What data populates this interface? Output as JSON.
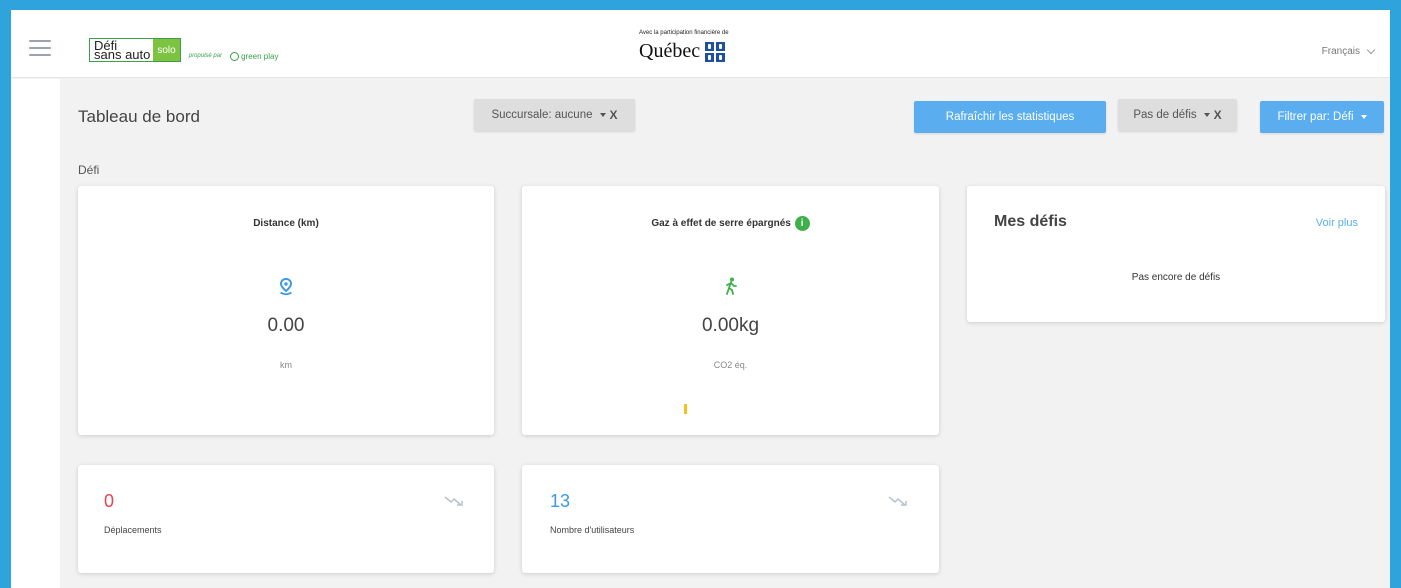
{
  "header": {
    "logo": {
      "line1": "Défi",
      "line2": "sans auto",
      "solo": "solo",
      "propulse": "propulsé par",
      "partner": "green play"
    },
    "quebec": {
      "caption": "Avec la participation financière de",
      "name": "Québec"
    },
    "language": "Français"
  },
  "toolbar": {
    "title": "Tableau de bord",
    "branch_filter": "Succursale: aucune",
    "refresh": "Rafraîchir les statistiques",
    "challenge_filter": "Pas de défis",
    "filter_by": "Filtrer par: Défi",
    "clear_symbol": "X"
  },
  "section": {
    "label": "Défi"
  },
  "distance_card": {
    "title": "Distance (km)",
    "value": "0.00",
    "unit": "km",
    "icon": "map-pin-icon"
  },
  "ghg_card": {
    "title": "Gaz à effet de serre épargnés",
    "info": "i",
    "value": "0.00kg",
    "unit": "CO2 éq.",
    "icon": "walking-person-icon"
  },
  "my_challenges": {
    "title": "Mes défis",
    "see_more": "Voir plus",
    "empty": "Pas encore de défis"
  },
  "trips_card": {
    "value": "0",
    "label": "Déplacements",
    "icon": "trend-down-icon"
  },
  "users_card": {
    "value": "13",
    "label": "Nombre d'utilisateurs",
    "icon": "trend-down-icon"
  },
  "colors": {
    "accent_blue": "#5aaef0",
    "frame_blue": "#2ea3dc",
    "trips_red": "#e8434f",
    "users_blue": "#3b9ae6",
    "green": "#3fb049"
  }
}
